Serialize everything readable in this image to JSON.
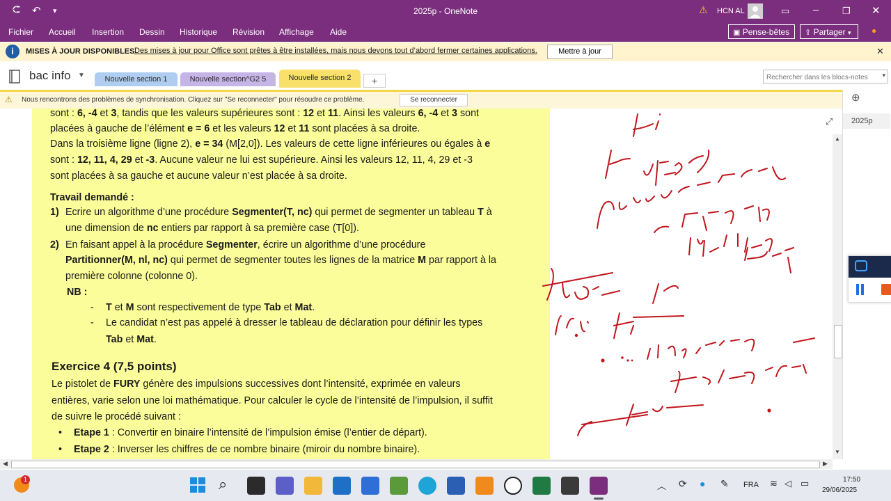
{
  "window": {
    "title": "2025p  -  OneNote",
    "user": "HCN AL"
  },
  "menu": [
    "Fichier",
    "Accueil",
    "Insertion",
    "Dessin",
    "Historique",
    "Révision",
    "Affichage",
    "Aide"
  ],
  "ribbon_right": {
    "pense_betes": "Pense-bêtes",
    "partager": "Partager"
  },
  "update_bar": {
    "title": "MISES À JOUR DISPONIBLES",
    "message": "Des mises à jour pour Office sont prêtes à être installées, mais nous devons tout d’abord fermer certaines applications.",
    "button": "Mettre à jour"
  },
  "notebook": {
    "name": "bac info"
  },
  "tabs": [
    {
      "label": "Nouvelle section 1",
      "color": "#aecdf0"
    },
    {
      "label": "Nouvelle section^G2 5",
      "color": "#c4b5e6"
    },
    {
      "label": "Nouvelle section 2",
      "color": "#f9e06b"
    }
  ],
  "search": {
    "placeholder": "Rechercher dans les blocs-notes"
  },
  "sync_bar": {
    "message": "Nous rencontrons des problèmes de synchronisation. Cliquez sur \"Se reconnecter\" pour résoudre ce problème.",
    "button": "Se reconnecter"
  },
  "page_list": {
    "item": "2025p"
  },
  "document": {
    "lines": [
      {
        "pre": "sont : ",
        "b1": "6, -4",
        "m1": " et ",
        "b2": "3",
        "m2": ", tandis que les valeurs supérieures sont : ",
        "b3": "12",
        "m3": " et ",
        "b4": "11",
        "m4": ". Ainsi les valeurs ",
        "b5": "6, -4",
        "m5": " et ",
        "b6": "3",
        "post": " sont"
      },
      {
        "pre": "placées à gauche de l’élément ",
        "b1": "e = 6",
        "m1": " et les valeurs ",
        "b2": "12",
        "m2": " et ",
        "b3": "11",
        "post": " sont placées à sa droite."
      },
      {
        "pre": "Dans la troisième ligne (ligne 2), ",
        "b1": "e = 34",
        "m1": " (M[2,0]). Les valeurs de cette ligne inférieures ou égales à ",
        "b2": "e",
        "post": ""
      },
      {
        "pre": "sont : ",
        "b1": "12, 11, 4, 29",
        "m1": " et ",
        "b2": "-3",
        "post": ". Aucune valeur ne lui est supérieure. Ainsi les valeurs 12, 11, 4, 29 et -3"
      },
      {
        "pre": "sont placées à sa gauche et aucune valeur n’est placée à sa droite.",
        "post": ""
      }
    ],
    "travail_title": "Travail demandé :",
    "q1_num": "1)",
    "q1_a_pre": "Ecrire un algorithme d’une procédure ",
    "q1_a_bold": "Segmenter(T, nc)",
    "q1_a_post": " qui permet de segmenter un tableau ",
    "q1_a_T": "T",
    "q1_a_end": " à",
    "q1_b_pre": "une dimension de ",
    "q1_b_bold": "nc",
    "q1_b_post": " entiers par rapport à sa première case (T[0]).",
    "q2_num": "2)",
    "q2_a_pre": "En faisant appel à la procédure ",
    "q2_a_bold": "Segmenter",
    "q2_a_post": ", écrire un algorithme d’une procédure",
    "q2_b_bold": "Partitionner(M, nl, nc)",
    "q2_b_post": " qui permet de segmenter toutes les lignes de la matrice ",
    "q2_b_M": "M",
    "q2_b_end": " par rapport à la",
    "q2_c": "première colonne (colonne 0).",
    "nb": "NB :",
    "nb1_T": "T",
    "nb1_m1": " et ",
    "nb1_M": "M",
    "nb1_m2": " sont respectivement de type ",
    "nb1_Tab": "Tab",
    "nb1_m3": " et ",
    "nb1_Mat": "Mat",
    "nb1_end": ".",
    "nb2_a": "Le candidat n’est pas appelé à dresser le tableau de déclaration pour définir les types",
    "nb2_b_Tab": "Tab",
    "nb2_b_m": " et ",
    "nb2_b_Mat": "Mat",
    "nb2_b_end": ".",
    "ex4_title": "Exercice 4 (7,5 points)",
    "ex4_a_pre": "Le pistolet de ",
    "ex4_a_bold": "FURY",
    "ex4_a_post": " génère des impulsions successives dont l’intensité, exprimée en valeurs",
    "ex4_b": "entières, varie selon une loi mathématique. Pour calculer le cycle de l’intensité de l’impulsion, il suffit",
    "ex4_c": "de suivre le procédé suivant :",
    "etape1_bold": "Etape 1",
    "etape1_text": " : Convertir en binaire l’intensité de l’impulsion émise (l’entier de départ).",
    "etape2_bold": "Etape 2",
    "etape2_text": " : Inverser les chiffres de ce nombre binaire (miroir du nombre binaire)."
  },
  "ink_color": "#c0151c",
  "taskbar": {
    "lang": "FRA",
    "time": "17:50",
    "date": "29/06/2025",
    "badge": "1"
  }
}
